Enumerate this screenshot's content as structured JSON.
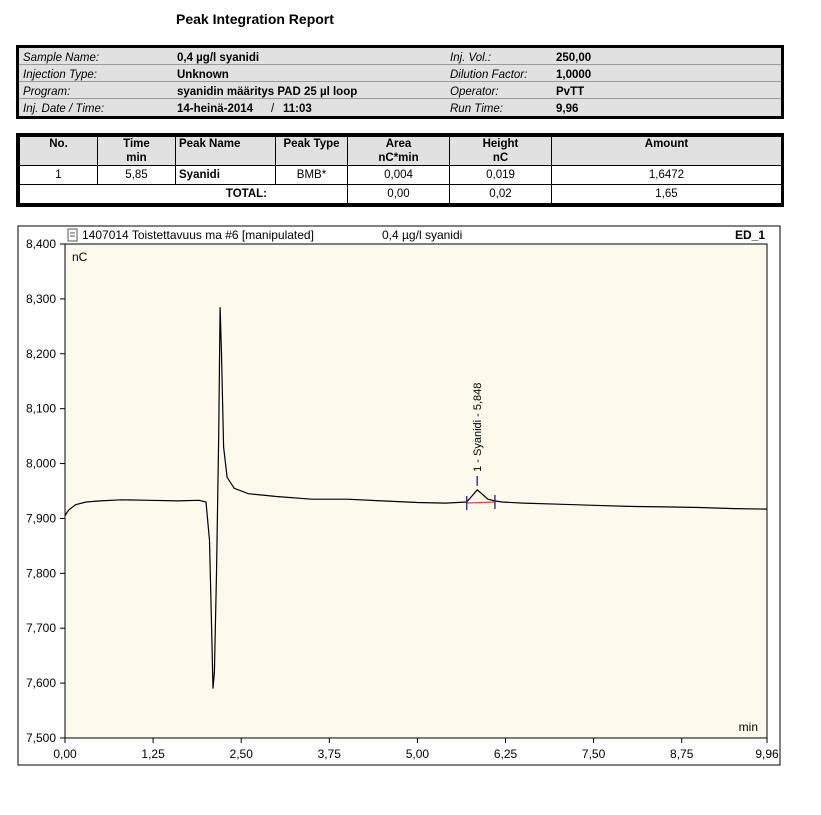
{
  "report_title": "Peak Integration Report",
  "info": [
    {
      "label": "Sample Name:",
      "value": "0,4 µg/l syanidi"
    },
    {
      "label": "Injection Type:",
      "value": "Unknown"
    },
    {
      "label": "Program:",
      "value": "syanidin määritys PAD 25 µl loop"
    },
    {
      "label": "Inj. Date / Time:",
      "value": "14-heinä-2014",
      "time_sep": "/",
      "time": "11:03"
    },
    {
      "label": "Inj. Vol.:",
      "value": "250,00"
    },
    {
      "label": "Dilution Factor:",
      "value": "1,0000"
    },
    {
      "label": "Operator:",
      "value": "PvTT"
    },
    {
      "label": "Run Time:",
      "value": "9,96"
    }
  ],
  "peak_table": {
    "headers": [
      {
        "top": "No.",
        "bottom": ""
      },
      {
        "top": "Time",
        "bottom": "min"
      },
      {
        "top": "Peak Name",
        "bottom": ""
      },
      {
        "top": "Peak Type",
        "bottom": ""
      },
      {
        "top": "Area",
        "bottom": "nC*min"
      },
      {
        "top": "Height",
        "bottom": "nC"
      },
      {
        "top": "Amount",
        "bottom": ""
      }
    ],
    "rows": [
      [
        "1",
        "5,85",
        "Syanidi",
        "BMB*",
        "0,004",
        "0,019",
        "1,6472"
      ]
    ],
    "total": {
      "label": "TOTAL:",
      "area": "0,00",
      "height": "0,02",
      "amount": "1,65"
    }
  },
  "chart_header": {
    "left": "1407014 Toistettavuus ma #6 [manipulated]",
    "center": "0,4 µg/l syanidi",
    "right": "ED_1"
  },
  "chart_data": {
    "type": "line",
    "ylabel": "nC",
    "xlabel": "min",
    "xlim": [
      0.0,
      9.96
    ],
    "ylim": [
      7.5,
      8.4
    ],
    "x_ticks": [
      "0,00",
      "1,25",
      "2,50",
      "3,75",
      "5,00",
      "6,25",
      "7,50",
      "8,75",
      "9,96"
    ],
    "x_tick_values": [
      0.0,
      1.25,
      2.5,
      3.75,
      5.0,
      6.25,
      7.5,
      8.75,
      9.96
    ],
    "y_ticks": [
      "7,500",
      "7,600",
      "7,700",
      "7,800",
      "7,900",
      "8,000",
      "8,100",
      "8,200",
      "8,300",
      "8,400"
    ],
    "y_tick_values": [
      7.5,
      7.6,
      7.7,
      7.8,
      7.9,
      8.0,
      8.1,
      8.2,
      8.3,
      8.4
    ],
    "series": [
      {
        "color": "#000000",
        "x": [
          0.0,
          0.05,
          0.15,
          0.3,
          0.5,
          0.8,
          1.2,
          1.6,
          1.9,
          2.0,
          2.05,
          2.08,
          2.1,
          2.12,
          2.15,
          2.18,
          2.2,
          2.22,
          2.25,
          2.3,
          2.4,
          2.6,
          3.0,
          3.5,
          4.0,
          4.5,
          5.0,
          5.4,
          5.7,
          5.85,
          6.0,
          6.1,
          6.2,
          6.5,
          7.0,
          7.5,
          8.0,
          8.5,
          9.0,
          9.5,
          9.96
        ],
        "y": [
          7.905,
          7.915,
          7.925,
          7.93,
          7.932,
          7.934,
          7.933,
          7.932,
          7.933,
          7.93,
          7.86,
          7.7,
          7.59,
          7.62,
          7.8,
          8.05,
          8.285,
          8.2,
          8.03,
          7.975,
          7.955,
          7.945,
          7.94,
          7.935,
          7.935,
          7.932,
          7.929,
          7.928,
          7.93,
          7.952,
          7.935,
          7.932,
          7.93,
          7.928,
          7.926,
          7.924,
          7.922,
          7.921,
          7.92,
          7.918,
          7.917
        ]
      }
    ],
    "baseline": {
      "color": "#e53935",
      "x": [
        5.7,
        6.1
      ],
      "y": [
        7.928,
        7.93
      ]
    },
    "peak_annotation": {
      "text": "1 - Syanidi - 5,848",
      "x": 5.848,
      "y": 7.952,
      "marker_color": "#1a237e"
    },
    "plot_background": "#fdf9ec",
    "grid": false
  }
}
